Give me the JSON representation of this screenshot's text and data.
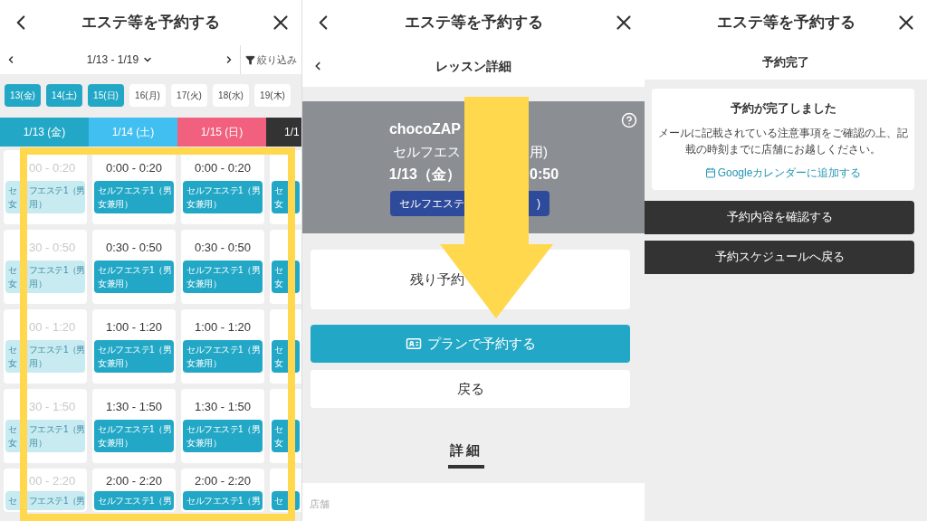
{
  "schedule_screen": {
    "title": "エステ等を予約する",
    "week_range": "1/13 - 1/19",
    "filter_label": "絞り込み",
    "days": [
      {
        "label": "13(金)",
        "selected": true
      },
      {
        "label": "14(土)",
        "selected": true
      },
      {
        "label": "15(日)",
        "selected": true
      },
      {
        "label": "16(月)",
        "selected": false
      },
      {
        "label": "17(火)",
        "selected": false
      },
      {
        "label": "18(水)",
        "selected": false
      },
      {
        "label": "19(木)",
        "selected": false
      }
    ],
    "columns": [
      {
        "label": "1/13 (金)",
        "color": "#22a8c6"
      },
      {
        "label": "1/14 (土)",
        "color": "#41bff0"
      },
      {
        "label": "1/15 (日)",
        "color": "#f1607e"
      },
      {
        "label": "1/1",
        "color": "#333333"
      }
    ],
    "rows": [
      [
        {
          "kind": "split",
          "disabled": true,
          "time": "00 - 0:20",
          "lines_left": [
            "セ",
            "女"
          ],
          "lines_right": [
            "フエステ1（男",
            "用）"
          ]
        },
        {
          "kind": "full",
          "disabled": false,
          "time": "0:00 - 0:20",
          "lines": [
            "セルフエステ1（男",
            "女兼用）"
          ]
        },
        {
          "kind": "full",
          "disabled": false,
          "time": "0:00 - 0:20",
          "lines": [
            "セルフエステ1（男",
            "女兼用）"
          ]
        },
        {
          "kind": "edge",
          "disabled": false,
          "lines_left": [
            "セ",
            "女"
          ]
        }
      ],
      [
        {
          "kind": "split",
          "disabled": true,
          "time": "30 - 0:50",
          "lines_left": [
            "セ",
            "女"
          ],
          "lines_right": [
            "フエステ1（男",
            "用）"
          ]
        },
        {
          "kind": "full",
          "disabled": false,
          "time": "0:30 - 0:50",
          "lines": [
            "セルフエステ1（男",
            "女兼用）"
          ]
        },
        {
          "kind": "full",
          "disabled": false,
          "time": "0:30 - 0:50",
          "lines": [
            "セルフエステ1（男",
            "女兼用）"
          ]
        },
        {
          "kind": "edge",
          "disabled": false,
          "lines_left": [
            "セ",
            "女"
          ]
        }
      ],
      [
        {
          "kind": "split",
          "disabled": true,
          "time": "00 - 1:20",
          "lines_left": [
            "セ",
            "女"
          ],
          "lines_right": [
            "フエステ1（男",
            "用）"
          ]
        },
        {
          "kind": "full",
          "disabled": false,
          "time": "1:00 - 1:20",
          "lines": [
            "セルフエステ1（男",
            "女兼用）"
          ]
        },
        {
          "kind": "full",
          "disabled": false,
          "time": "1:00 - 1:20",
          "lines": [
            "セルフエステ1（男",
            "女兼用）"
          ]
        },
        {
          "kind": "edge",
          "disabled": false,
          "lines_left": [
            "セ",
            "女"
          ]
        }
      ],
      [
        {
          "kind": "split",
          "disabled": true,
          "time": "30 - 1:50",
          "lines_left": [
            "セ",
            "女"
          ],
          "lines_right": [
            "フエステ1（男",
            "用）"
          ]
        },
        {
          "kind": "full",
          "disabled": false,
          "time": "1:30 - 1:50",
          "lines": [
            "セルフエステ1（男",
            "女兼用）"
          ]
        },
        {
          "kind": "full",
          "disabled": false,
          "time": "1:30 - 1:50",
          "lines": [
            "セルフエステ1（男",
            "女兼用）"
          ]
        },
        {
          "kind": "edge",
          "disabled": false,
          "lines_left": [
            "セ",
            "女"
          ]
        }
      ],
      [
        {
          "kind": "split",
          "disabled": true,
          "time": "00 - 2:20",
          "lines_left": [
            "セ"
          ],
          "lines_right": [
            "フエステ1（男"
          ]
        },
        {
          "kind": "full",
          "disabled": false,
          "time": "2:00 - 2:20",
          "lines": [
            "セルフエステ1（男"
          ]
        },
        {
          "kind": "full",
          "disabled": false,
          "time": "2:00 - 2:20",
          "lines": [
            "セルフエステ1（男"
          ]
        },
        {
          "kind": "edge",
          "disabled": false,
          "lines_left": [
            "セ"
          ]
        }
      ]
    ]
  },
  "detail_screen": {
    "title": "エステ等を予約する",
    "subtitle": "レッスン詳細",
    "photo": {
      "store_name": "chocoZAP",
      "plan": "セルフエス",
      "plan_tail": "用)",
      "date": "1/13（金）",
      "time_tail": "0:50",
      "tag": "セルフエステ",
      "tag_tail": ")"
    },
    "remaining": "残り予約",
    "reserve_button": "プランで予約する",
    "back_button": "戻る",
    "section_heading": "詳細",
    "store_label": "店舗"
  },
  "complete_screen": {
    "title": "エステ等を予約する",
    "subtitle": "予約完了",
    "heading": "予約が完了しました",
    "message": "メールに記載されている注意事項をご確認の上、記載の時刻までに店舗にお越しください。",
    "calendar_link": "Googleカレンダーに追加する",
    "buttons": [
      "予約内容を確認する",
      "予約スケジュールへ戻る"
    ]
  }
}
